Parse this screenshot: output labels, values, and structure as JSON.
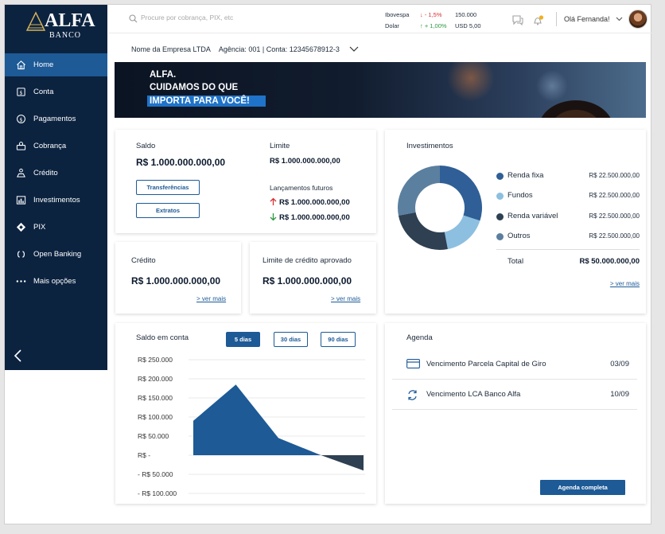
{
  "brand": {
    "name": "ALFA",
    "sub": "BANCO"
  },
  "sidebar": {
    "items": [
      {
        "label": "Home",
        "icon": "home-icon"
      },
      {
        "label": "Conta",
        "icon": "account-icon"
      },
      {
        "label": "Pagamentos",
        "icon": "payments-icon"
      },
      {
        "label": "Cobrança",
        "icon": "billing-icon"
      },
      {
        "label": "Crédito",
        "icon": "credit-icon"
      },
      {
        "label": "Investimentos",
        "icon": "investments-icon"
      },
      {
        "label": "PIX",
        "icon": "pix-icon"
      },
      {
        "label": "Open Banking",
        "icon": "open-banking-icon"
      },
      {
        "label": "Mais opções",
        "icon": "more-dots-icon"
      }
    ],
    "active_index": 0
  },
  "search": {
    "placeholder": "Procure por cobrança, PIX, etc"
  },
  "market": {
    "ibovespa_label": "Ibovespa",
    "ibovespa_change": "↓ - 1,5%",
    "ibovespa_value": "150.000",
    "dolar_label": "Dolar",
    "dolar_change": "↑ + 1,00%",
    "dolar_value": "USD 5,00"
  },
  "user": {
    "greeting": "Olá Fernanda!"
  },
  "company": {
    "name": "Nome da Empresa LTDA",
    "account": "Agência: 001 | Conta: 12345678912-3"
  },
  "banner": {
    "line1": "ALFA.",
    "line2": "CUIDAMOS DO QUE",
    "line3": "IMPORTA PARA VOCÊ!"
  },
  "saldo": {
    "label": "Saldo",
    "value": "R$ 1.000.000.000,00",
    "btn_transfer": "Transferências",
    "btn_extract": "Extratos",
    "limit_label": "Limite",
    "limit_value": "R$ 1.000.000.000,00",
    "future_label": "Lançamentos futuros",
    "future_in": "R$ 1.000.000.000,00",
    "future_out": "R$ 1.000.000.000,00"
  },
  "credito": {
    "label": "Crédito",
    "value": "R$ 1.000.000.000,00",
    "link": "> ver mais"
  },
  "limite_aprovado": {
    "label": "Limite de crédito aprovado",
    "value": "R$ 1.000.000.000,00",
    "link": "> ver mais"
  },
  "investimentos": {
    "title": "Investimentos",
    "total_label": "Total",
    "total_value": "R$ 50.000.000,00",
    "link": "> ver mais"
  },
  "agenda": {
    "title": "Agenda",
    "items": [
      {
        "text": "Vencimento Parcela Capital de Giro",
        "date": "03/09",
        "icon": "card-icon"
      },
      {
        "text": "Vencimento LCA Banco Alfa",
        "date": "10/09",
        "icon": "exchange-icon"
      }
    ],
    "button": "Agenda completa"
  },
  "balance_chart": {
    "title": "Saldo em conta",
    "tabs": [
      "5 dias",
      "30 dias",
      "90 dias"
    ],
    "active_tab": 0
  },
  "colors": {
    "navy": "#0c2340",
    "primary": "#1d5a96",
    "renda_fixa": "#2f5f96",
    "fundos": "#8dbfe0",
    "renda_variavel": "#2e4052",
    "outros": "#5b7f9f"
  },
  "chart_data": [
    {
      "type": "pie",
      "title": "Investimentos",
      "categories": [
        "Renda fixa",
        "Fundos",
        "Renda variável",
        "Outros"
      ],
      "values": [
        22500000.0,
        22500000.0,
        22500000.0,
        22500000.0
      ],
      "value_labels": [
        "R$ 22.500.000,00",
        "R$ 22.500.000,00",
        "R$ 22.500.000,00",
        "R$ 22.500.000,00"
      ],
      "display_shares": [
        0.3,
        0.17,
        0.25,
        0.28
      ],
      "colors": [
        "#2f5f96",
        "#8dbfe0",
        "#2e4052",
        "#5b7f9f"
      ]
    },
    {
      "type": "area",
      "title": "Saldo em conta",
      "x": [
        1,
        2,
        3,
        4,
        5
      ],
      "y": [
        90000,
        185000,
        45000,
        0,
        -40000
      ],
      "ylim": [
        -100000,
        250000
      ],
      "yticks": [
        250000,
        200000,
        150000,
        100000,
        50000,
        0,
        -50000,
        -100000
      ],
      "ytick_labels": [
        "R$ 250.000",
        "R$ 200.000",
        "R$ 150.000",
        "R$ 100.000",
        "R$ 50.000",
        "R$ -",
        "- R$ 50.000",
        "- R$ 100.000"
      ],
      "pos_color": "#1d5a96",
      "neg_color": "#2e4052"
    }
  ]
}
